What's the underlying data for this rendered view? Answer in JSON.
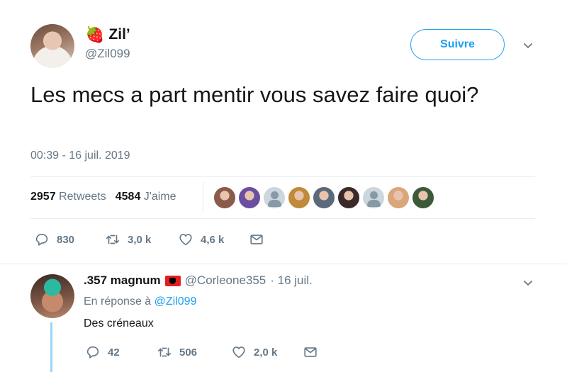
{
  "main_tweet": {
    "author_emoji": "🍓",
    "author_name": "Zil’",
    "handle": "@Zil099",
    "follow_label": "Suivre",
    "text": "Les mecs a part mentir vous savez faire quoi?",
    "timestamp": "00:39 - 16 juil. 2019",
    "stats": {
      "retweets_count": "2957",
      "retweets_label": "Retweets",
      "likes_count": "4584",
      "likes_label": "J'aime"
    },
    "likers": [
      {
        "type": "photo",
        "color": "#8a5a4a"
      },
      {
        "type": "photo",
        "color": "#6b4ea0"
      },
      {
        "type": "placeholder",
        "color": "#ccd6dd"
      },
      {
        "type": "photo",
        "color": "#c08a3a"
      },
      {
        "type": "photo",
        "color": "#5a6a7a"
      },
      {
        "type": "photo",
        "color": "#3a2a2a"
      },
      {
        "type": "placeholder",
        "color": "#ccd6dd"
      },
      {
        "type": "photo",
        "color": "#d9a77a"
      },
      {
        "type": "photo",
        "color": "#3c5a3a"
      }
    ],
    "actions": {
      "reply_count": "830",
      "retweet_count": "3,0 k",
      "like_count": "4,6 k"
    }
  },
  "reply_tweet": {
    "author_name": ".357 magnum",
    "handle": "@Corleone355",
    "date": "· 16 juil.",
    "in_reply_prefix": "En réponse à",
    "in_reply_handle": "@Zil099",
    "text": "Des créneaux",
    "actions": {
      "reply_count": "42",
      "retweet_count": "506",
      "like_count": "2,0 k"
    }
  },
  "colors": {
    "accent": "#1da1f2",
    "secondary_text": "#657786",
    "divider": "#e6ecf0",
    "thread_line": "#9ad4f9",
    "flag_red": "#e41e20"
  }
}
